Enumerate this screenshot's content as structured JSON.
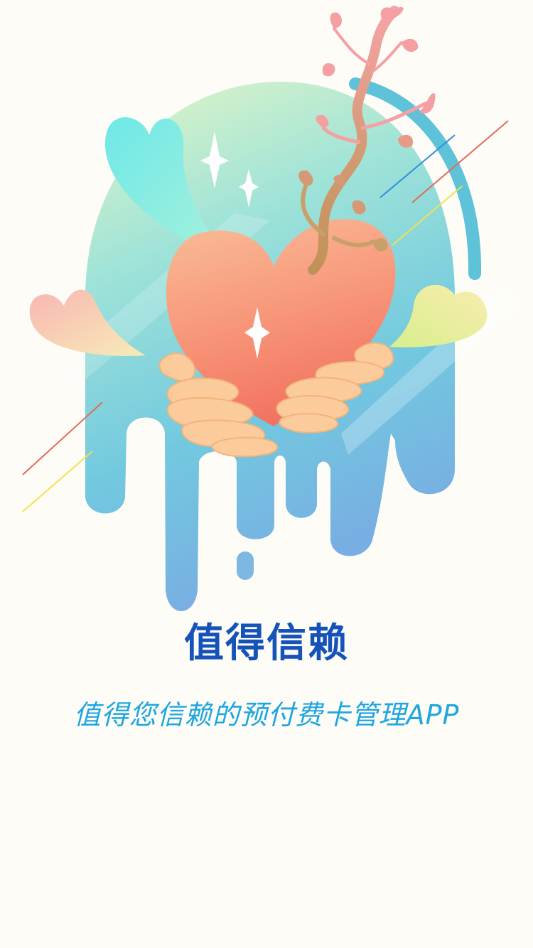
{
  "splash": {
    "headline": "值得信赖",
    "subtitle": "值得您信赖的预付费卡管理APP",
    "illustration_icon": "heart-in-hands-sprout-illustration",
    "colors": {
      "background": "#fdfcf7",
      "headline": "#1553b8",
      "subtitle": "#1fa6df",
      "heart": "#f58a6e",
      "sprout": "#c9a06a",
      "leaves": "#f08a8c",
      "hands": "#fccb9c",
      "blob_top": "#d8f3c0",
      "blob_bottom": "#6fb2e6"
    }
  }
}
